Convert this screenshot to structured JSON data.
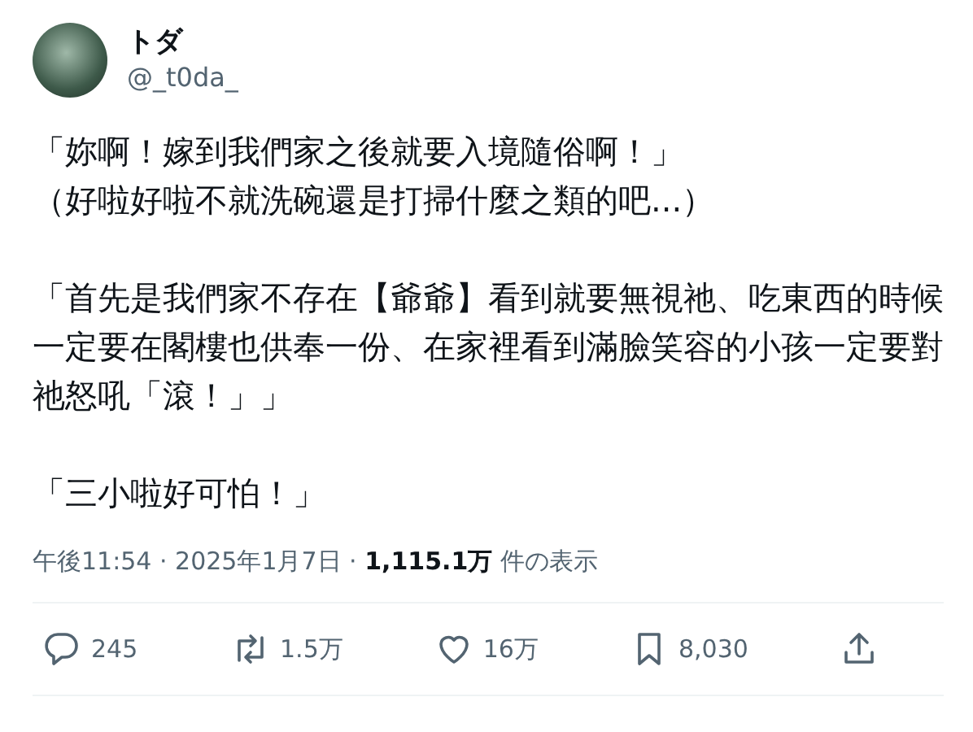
{
  "author": {
    "name": "トダ",
    "handle": "@_t0da_"
  },
  "body": {
    "paragraphs": [
      {
        "lines": [
          "「妳啊！嫁到我們家之後就要入境隨俗啊！」",
          "（好啦好啦不就洗碗還是打掃什麼之類的吧...）"
        ]
      },
      {
        "lines": [
          "「首先是我們家不存在【爺爺】看到就要無視祂、吃東西的時候一定要在閣樓也供奉一份、在家裡看到滿臉笑容的小孩一定要對祂怒吼「滾！」」"
        ]
      },
      {
        "lines": [
          "「三小啦好可怕！」"
        ]
      }
    ]
  },
  "meta": "午後11:54 · 2025年1月7日 · **1,115.1万** 件の表示",
  "actions": [
    {
      "kind": "reply",
      "count": "245"
    },
    {
      "kind": "repost",
      "count": "1.5万"
    },
    {
      "kind": "like",
      "count": "16万"
    },
    {
      "kind": "bookmark",
      "count": "8,030"
    },
    {
      "kind": "share"
    }
  ]
}
